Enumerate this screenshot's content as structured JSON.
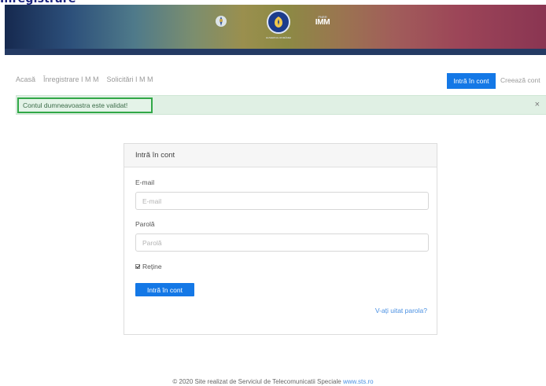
{
  "nav": {
    "home": "Acasă",
    "register_imm": "Înregistrare I M M",
    "requests_imm": "Solicitări I M M",
    "login_button": "Intră în cont",
    "create_account": "Creează cont"
  },
  "alert": {
    "message": "Contul dumneavoastra este validat!",
    "close": "×"
  },
  "login_card": {
    "header": "Intră în cont",
    "email_label": "E-mail",
    "email_placeholder": "E-mail",
    "password_label": "Parolă",
    "password_placeholder": "Parolă",
    "remember_label": "Reține",
    "remember_checked": true,
    "submit_label": "Intră în cont",
    "forgot_link": "V-ați uitat parola?"
  },
  "footer": {
    "text": "© 2020 Site realizat de Serviciul de Telecomunicatii Speciale",
    "link": "www.sts.ro"
  },
  "colors": {
    "primary": "#1478e6",
    "success_bg": "#e0f0e4",
    "success_border": "#31a847",
    "link": "#4a90e2"
  }
}
